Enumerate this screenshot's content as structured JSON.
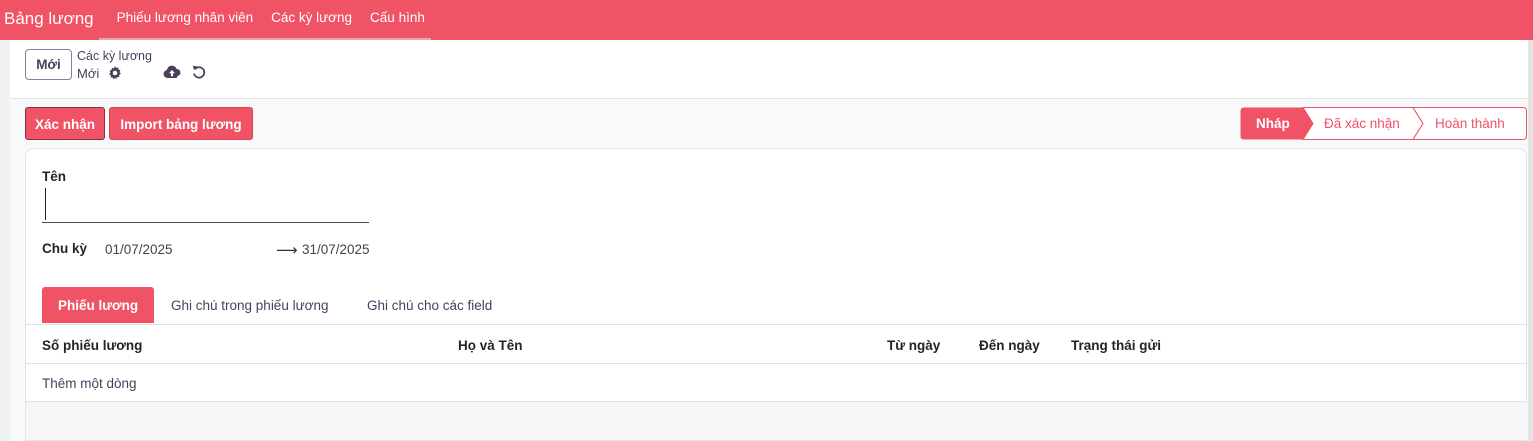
{
  "app": {
    "title": "Bảng lương",
    "menu": [
      "Phiếu lương nhân viên",
      "Các kỳ lương",
      "Cấu hình"
    ]
  },
  "control_panel": {
    "new_button": "Mới",
    "breadcrumb_parent": "Các kỳ lương",
    "breadcrumb_current": "Mới",
    "icons": [
      "gear-icon",
      "cloud-upload-icon",
      "undo-icon"
    ]
  },
  "actions": {
    "confirm": "Xác nhận",
    "import": "Import bảng lương"
  },
  "status_bar": {
    "stages": [
      "Nháp",
      "Đã xác nhận",
      "Hoàn thành"
    ],
    "active_index": 0
  },
  "form": {
    "name_label": "Tên",
    "name_value": "",
    "period_label": "Chu kỳ",
    "date_from": "01/07/2025",
    "date_to": "31/07/2025",
    "arrow": "⟶"
  },
  "tabs": [
    "Phiếu lương",
    "Ghi chú trong phiếu lương",
    "Ghi chú cho các field"
  ],
  "table": {
    "columns": [
      "Số phiếu lương",
      "Họ và Tên",
      "Từ ngày",
      "Đến ngày",
      "Trạng thái gửi"
    ],
    "add_line": "Thêm một dòng"
  },
  "colors": {
    "primary": "#f05266",
    "text_muted": "#4a3f5c"
  }
}
